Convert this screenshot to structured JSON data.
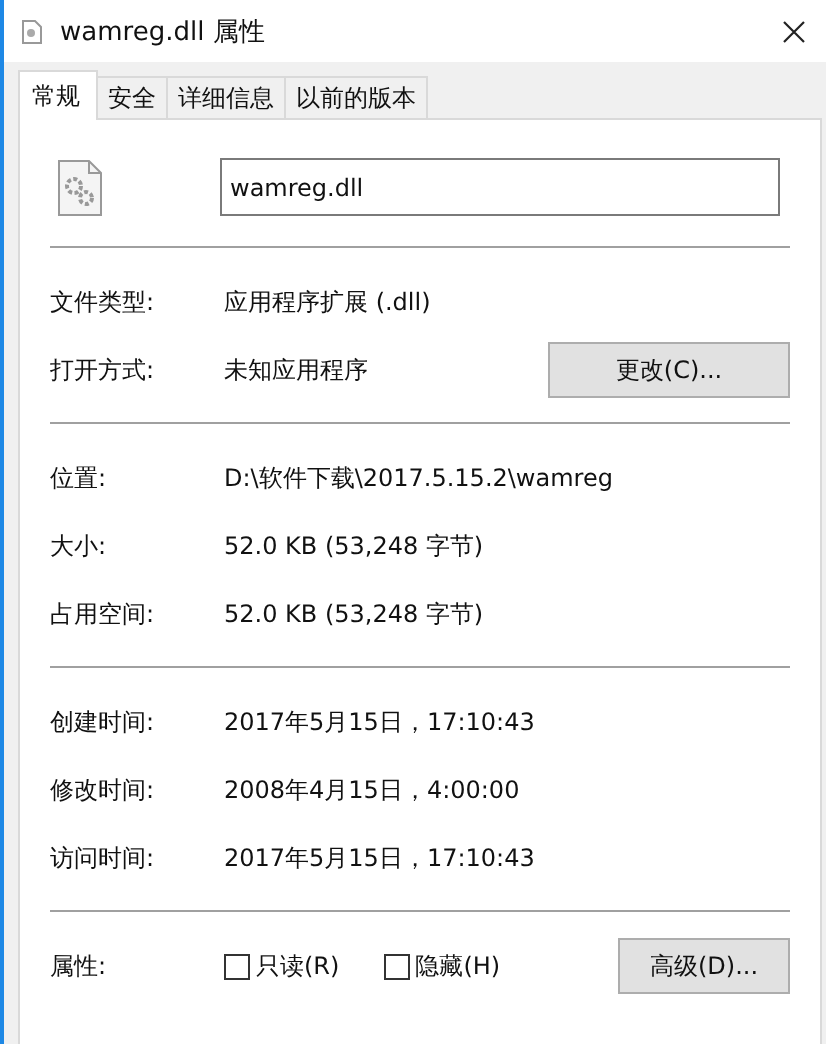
{
  "window": {
    "title": "wamreg.dll 属性"
  },
  "tabs": [
    {
      "label": "常规",
      "selected": true
    },
    {
      "label": "安全",
      "selected": false
    },
    {
      "label": "详细信息",
      "selected": false
    },
    {
      "label": "以前的版本",
      "selected": false
    }
  ],
  "file_name": {
    "value": "wamreg.dll"
  },
  "sections": [
    [
      {
        "label": "文件类型:",
        "value": "应用程序扩展 (.dll)"
      },
      {
        "label": "打开方式:",
        "value": "未知应用程序",
        "button": "更改(C)..."
      }
    ],
    [
      {
        "label": "位置:",
        "value": "D:\\软件下载\\2017.5.15.2\\wamreg"
      },
      {
        "label": "大小:",
        "value": "52.0 KB (53,248 字节)"
      },
      {
        "label": "占用空间:",
        "value": "52.0 KB (53,248 字节)"
      }
    ],
    [
      {
        "label": "创建时间:",
        "value": "2017年5月15日，17:10:43"
      },
      {
        "label": "修改时间:",
        "value": "2008年4月15日，4:00:00"
      },
      {
        "label": "访问时间:",
        "value": "2017年5月15日，17:10:43"
      }
    ]
  ],
  "attributes": {
    "label": "属性:",
    "checkboxes": [
      {
        "label": "只读(R)",
        "checked": false
      },
      {
        "label": "隐藏(H)",
        "checked": false
      }
    ],
    "button": "高级(D)..."
  }
}
